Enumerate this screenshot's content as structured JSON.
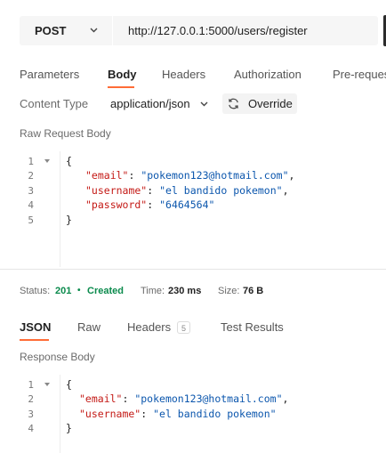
{
  "request": {
    "method": "POST",
    "url": "http://127.0.0.1:5000/users/register"
  },
  "tabs": [
    {
      "label": "Parameters"
    },
    {
      "label": "Body"
    },
    {
      "label": "Headers"
    },
    {
      "label": "Authorization"
    },
    {
      "label": "Pre-reques"
    }
  ],
  "body_settings": {
    "content_type_label": "Content Type",
    "content_type_value": "application/json",
    "override_label": "Override",
    "raw_label": "Raw Request Body"
  },
  "request_body": {
    "line_numbers": [
      "1",
      "2",
      "3",
      "4",
      "5"
    ],
    "open_brace": "{",
    "close_brace": "}",
    "fields": [
      {
        "key": "\"email\"",
        "colon": ": ",
        "value": "\"pokemon123@hotmail.com\"",
        "comma": ","
      },
      {
        "key": "\"username\"",
        "colon": ": ",
        "value": "\"el bandido pokemon\"",
        "comma": ","
      },
      {
        "key": "\"password\"",
        "colon": ": ",
        "value": "\"6464564\"",
        "comma": ""
      }
    ]
  },
  "response_status": {
    "status_label": "Status:",
    "status_code": "201",
    "status_text": "Created",
    "time_label": "Time:",
    "time_value": "230 ms",
    "size_label": "Size:",
    "size_value": "76 B",
    "accent_color": "#0a8a4c"
  },
  "response_tabs": [
    {
      "label": "JSON"
    },
    {
      "label": "Raw"
    },
    {
      "label": "Headers",
      "badge": "5"
    },
    {
      "label": "Test Results"
    }
  ],
  "response_body": {
    "label": "Response Body",
    "line_numbers": [
      "1",
      "2",
      "3",
      "4"
    ],
    "open_brace": "{",
    "close_brace": "}",
    "fields": [
      {
        "key": "\"email\"",
        "colon": ": ",
        "value": "\"pokemon123@hotmail.com\"",
        "comma": ","
      },
      {
        "key": "\"username\"",
        "colon": ": ",
        "value": "\"el bandido pokemon\"",
        "comma": ""
      }
    ]
  },
  "colors": {
    "active_tab_underline": "#ff6c37",
    "json_key": "#c41a16",
    "json_string": "#0b56ad"
  }
}
